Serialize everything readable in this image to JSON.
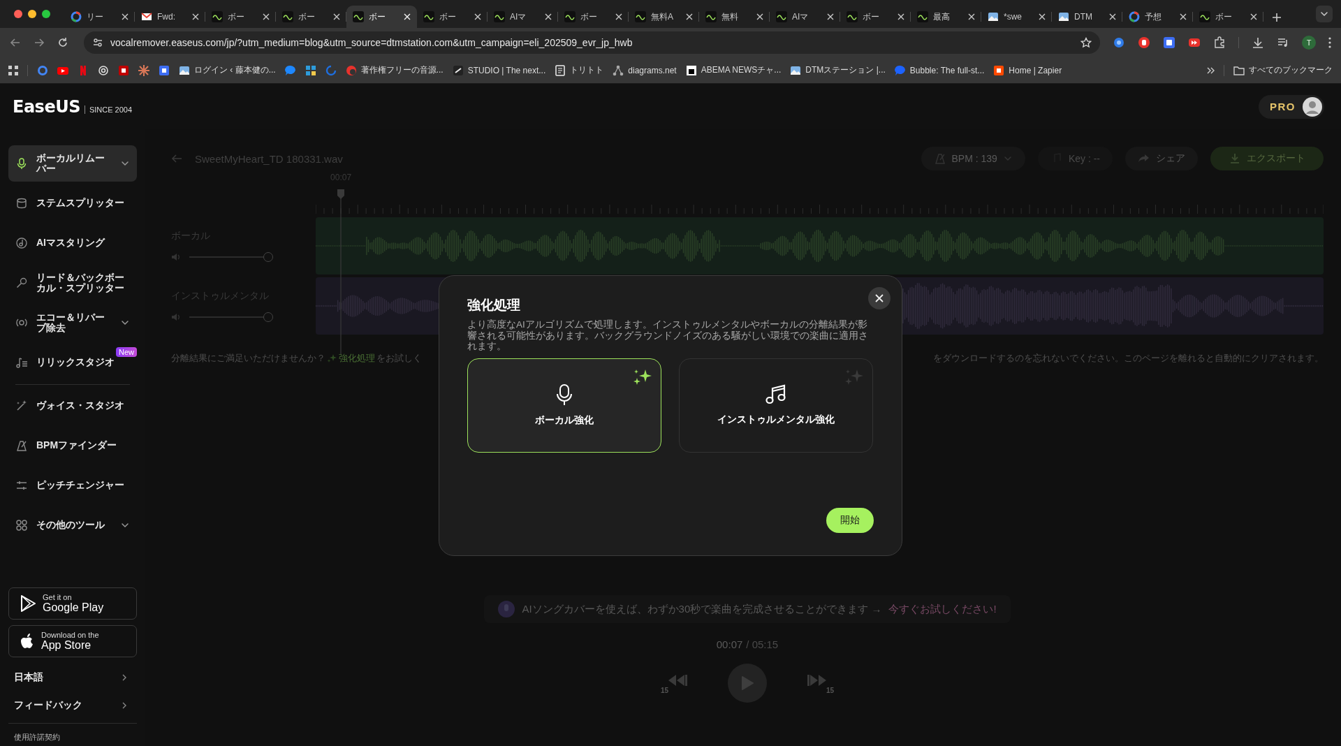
{
  "browser": {
    "tabs": [
      {
        "title": "リー",
        "selected": false
      },
      {
        "title": "Fwd:",
        "selected": false
      },
      {
        "title": "ボー",
        "selected": false
      },
      {
        "title": "ボー",
        "selected": false
      },
      {
        "title": "ボー",
        "selected": true
      },
      {
        "title": "ボー",
        "selected": false
      },
      {
        "title": "AIマ",
        "selected": false
      },
      {
        "title": "ボー",
        "selected": false
      },
      {
        "title": "無料A",
        "selected": false
      },
      {
        "title": "無料",
        "selected": false
      },
      {
        "title": "AIマ",
        "selected": false
      },
      {
        "title": "ボー",
        "selected": false
      },
      {
        "title": "最高",
        "selected": false
      },
      {
        "title": "*swe",
        "selected": false
      },
      {
        "title": "DTM",
        "selected": false
      },
      {
        "title": "予想",
        "selected": false
      },
      {
        "title": "ボー",
        "selected": false
      }
    ],
    "address": "vocalremover.easeus.com/jp/?utm_medium=blog&utm_source=dtmstation.com&utm_campaign=eli_202509_evr_jp_hwb",
    "profile_initial": "T",
    "bookmarks": [
      {
        "kind": "icon"
      },
      {
        "kind": "icon"
      },
      {
        "kind": "icon"
      },
      {
        "kind": "icon"
      },
      {
        "kind": "icon"
      },
      {
        "kind": "icon"
      },
      {
        "kind": "icon"
      },
      {
        "kind": "link",
        "title": "ログイン ‹ 藤本健の..."
      },
      {
        "kind": "icon"
      },
      {
        "kind": "icon"
      },
      {
        "kind": "icon"
      },
      {
        "kind": "link",
        "title": "著作権フリーの音源..."
      },
      {
        "kind": "link",
        "title": "STUDIO | The next..."
      },
      {
        "kind": "link",
        "title": "トリトト"
      },
      {
        "kind": "link",
        "title": "diagrams.net"
      },
      {
        "kind": "link",
        "title": "ABEMA NEWSチャ..."
      },
      {
        "kind": "link",
        "title": "DTMステーション |..."
      },
      {
        "kind": "link",
        "title": "Bubble: The full-st..."
      },
      {
        "kind": "link",
        "title": "Home | Zapier"
      }
    ],
    "all_bookmarks": "すべてのブックマーク"
  },
  "app": {
    "logo": "EaseUS",
    "since": "SINCE 2004",
    "plan_badge": "PRO"
  },
  "sidebar": {
    "groups": [
      [
        {
          "label": "ボーカルリムーバー",
          "selected": true,
          "expandable": true
        },
        {
          "label": "ステムスプリッター",
          "selected": false,
          "expandable": false
        },
        {
          "label": "AIマスタリング",
          "selected": false,
          "expandable": false
        },
        {
          "label": "リード＆バックボーカル・スプリッター",
          "selected": false,
          "expandable": false
        },
        {
          "label": "エコー＆リバーブ除去",
          "selected": false,
          "expandable": true
        },
        {
          "label": "リリックスタジオ",
          "selected": false,
          "expandable": false,
          "badge": "New"
        }
      ],
      [
        {
          "label": "ヴォイス・スタジオ",
          "selected": false,
          "expandable": false
        },
        {
          "label": "BPMファインダー",
          "selected": false,
          "expandable": false
        },
        {
          "label": "ピッチチェンジャー",
          "selected": false,
          "expandable": false
        },
        {
          "label": "その他のツール",
          "selected": false,
          "expandable": true
        }
      ]
    ],
    "store_buttons": [
      {
        "kind": "play",
        "small": "Get it on",
        "large": "Google Play"
      },
      {
        "kind": "apple",
        "small": "Download on the",
        "large": "App Store"
      }
    ],
    "links": [
      {
        "label": "日本語"
      },
      {
        "label": "フィードバック"
      }
    ],
    "license": "使用許諾契約"
  },
  "editor": {
    "file_name": "SweetMyHeart_TD 180331.wav",
    "actions": [
      {
        "kind": "bpm",
        "label": "BPM : 139"
      },
      {
        "kind": "key",
        "label": "Key : --"
      },
      {
        "kind": "share",
        "label": "シェア"
      },
      {
        "kind": "export",
        "label": "エクスポート"
      }
    ],
    "playhead": {
      "time": "00:07",
      "level": 0.025
    },
    "tracks": [
      {
        "kind": "vocal",
        "name": "ボーカル",
        "volume": {
          "level": 1
        }
      },
      {
        "kind": "instrumental",
        "name": "インストゥルメンタル",
        "volume": {
          "level": 1
        }
      }
    ],
    "notice": {
      "lead": "分離結果にご満足いただけませんか？",
      "link": "強化処理",
      "after": "をお試しく",
      "tail": "をダウンロードするのを忘れないでください。このページを離れると自動的にクリアされます。"
    },
    "promo": {
      "text": "AIソングカバーを使えば、わずか30秒で楽曲を完成させることができます →",
      "link": "今すぐお試しください!"
    },
    "time": {
      "current": "00:07",
      "total": "/ 05:15"
    },
    "transport": {
      "skip_back": "15",
      "skip_forward": "15"
    }
  },
  "dialog": {
    "title": "強化処理",
    "description": "より高度なAIアルゴリズムで処理します。インストゥルメンタルやボーカルの分離結果が影響される可能性があります。バックグラウンドノイズのある騒がしい環境での楽曲に適用されます。",
    "options": [
      {
        "kind": "vocal",
        "label": "ボーカル強化",
        "selected": true
      },
      {
        "kind": "instrumental",
        "label": "インストゥルメンタル強化",
        "selected": false
      }
    ],
    "start": "開始"
  }
}
